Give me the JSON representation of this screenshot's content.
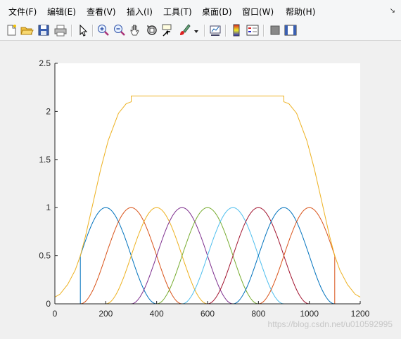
{
  "menu": {
    "items": [
      "文件(F)",
      "编辑(E)",
      "查看(V)",
      "插入(I)",
      "工具(T)",
      "桌面(D)",
      "窗口(W)",
      "帮助(H)"
    ],
    "dock_glyph": "↘"
  },
  "toolbar": {
    "buttons": [
      "new-figure-icon",
      "open-file-icon",
      "save-icon",
      "print-icon",
      "pointer-arrow-icon",
      "zoom-in-icon",
      "zoom-out-icon",
      "pan-hand-icon",
      "rotate-3d-icon",
      "data-cursor-icon",
      "brush-icon",
      "brush-dropdown-icon",
      "link-plot-icon",
      "colorbar-icon",
      "legend-icon",
      "hide-plot-tools-icon",
      "show-plot-tools-icon"
    ]
  },
  "watermark": "https://blog.csdn.net/u010592995",
  "chart_data": {
    "type": "line",
    "xlim": [
      0,
      1200
    ],
    "ylim": [
      0,
      2.5
    ],
    "xticks": [
      0,
      200,
      400,
      600,
      800,
      1000,
      1200
    ],
    "xtick_labels": [
      "0",
      "200",
      "400",
      "600",
      "800",
      "1000",
      "1200"
    ],
    "yticks": [
      0,
      0.5,
      1,
      1.5,
      2,
      2.5
    ],
    "ytick_labels": [
      "0",
      "0.5",
      "1",
      "1.5",
      "2",
      "2.5"
    ],
    "grid": false,
    "legend": "none",
    "series": [
      {
        "color": "#0072bd",
        "center": 200,
        "support": [
          100,
          300
        ],
        "points": [
          [
            0,
            0
          ],
          [
            100,
            0
          ],
          [
            100,
            0.5
          ],
          [
            150,
            0.85
          ],
          [
            200,
            1
          ],
          [
            250,
            0.85
          ],
          [
            300,
            0.5
          ],
          [
            350,
            0.15
          ],
          [
            400,
            0
          ],
          [
            1200,
            0
          ]
        ]
      },
      {
        "color": "#d95319",
        "center": 300,
        "support": [
          200,
          400
        ],
        "points": [
          [
            0,
            0
          ],
          [
            100,
            0
          ],
          [
            100,
            0.15
          ],
          [
            200,
            0.5
          ],
          [
            250,
            0.85
          ],
          [
            300,
            1
          ],
          [
            350,
            0.85
          ],
          [
            400,
            0.5
          ],
          [
            450,
            0.15
          ],
          [
            500,
            0
          ],
          [
            1200,
            0
          ]
        ]
      },
      {
        "color": "#edb120",
        "center": 400,
        "points": [
          [
            0,
            0
          ],
          [
            200,
            0
          ],
          [
            200,
            0.15
          ],
          [
            300,
            0.5
          ],
          [
            350,
            0.85
          ],
          [
            400,
            1
          ],
          [
            450,
            0.85
          ],
          [
            500,
            0.5
          ],
          [
            550,
            0.15
          ],
          [
            600,
            0
          ],
          [
            1200,
            0
          ]
        ]
      },
      {
        "color": "#7e2f8e",
        "center": 500,
        "points": [
          [
            0,
            0
          ],
          [
            300,
            0
          ],
          [
            300,
            0.15
          ],
          [
            400,
            0.5
          ],
          [
            450,
            0.85
          ],
          [
            500,
            1
          ],
          [
            550,
            0.85
          ],
          [
            600,
            0.5
          ],
          [
            650,
            0.15
          ],
          [
            700,
            0
          ],
          [
            1200,
            0
          ]
        ]
      },
      {
        "color": "#77ac30",
        "center": 600,
        "points": [
          [
            0,
            0
          ],
          [
            400,
            0
          ],
          [
            400,
            0.15
          ],
          [
            500,
            0.5
          ],
          [
            550,
            0.85
          ],
          [
            600,
            1
          ],
          [
            650,
            0.85
          ],
          [
            700,
            0.5
          ],
          [
            750,
            0.15
          ],
          [
            800,
            0
          ],
          [
            1200,
            0
          ]
        ]
      },
      {
        "color": "#4dbeee",
        "center": 700,
        "points": [
          [
            0,
            0
          ],
          [
            500,
            0
          ],
          [
            500,
            0.15
          ],
          [
            600,
            0.5
          ],
          [
            650,
            0.85
          ],
          [
            700,
            1
          ],
          [
            750,
            0.85
          ],
          [
            800,
            0.5
          ],
          [
            850,
            0.15
          ],
          [
            900,
            0
          ],
          [
            1200,
            0
          ]
        ]
      },
      {
        "color": "#a2142f",
        "center": 800,
        "points": [
          [
            0,
            0
          ],
          [
            600,
            0
          ],
          [
            600,
            0.15
          ],
          [
            700,
            0.5
          ],
          [
            750,
            0.85
          ],
          [
            800,
            1
          ],
          [
            850,
            0.85
          ],
          [
            900,
            0.5
          ],
          [
            950,
            0.15
          ],
          [
            1000,
            0
          ],
          [
            1200,
            0
          ]
        ]
      },
      {
        "color": "#0072bd",
        "center": 900,
        "points": [
          [
            0,
            0
          ],
          [
            700,
            0
          ],
          [
            700,
            0.15
          ],
          [
            800,
            0.5
          ],
          [
            850,
            0.85
          ],
          [
            900,
            1
          ],
          [
            950,
            0.85
          ],
          [
            1000,
            0.5
          ],
          [
            1050,
            0.15
          ],
          [
            1100,
            0
          ],
          [
            1200,
            0
          ]
        ]
      },
      {
        "color": "#d95319",
        "center": 1000,
        "points": [
          [
            0,
            0
          ],
          [
            800,
            0
          ],
          [
            800,
            0.15
          ],
          [
            900,
            0.5
          ],
          [
            950,
            0.85
          ],
          [
            1000,
            1
          ],
          [
            1050,
            0.85
          ],
          [
            1100,
            0.5
          ],
          [
            1100,
            0
          ],
          [
            1200,
            0
          ]
        ]
      },
      {
        "color": "#edb120",
        "name_shown": false,
        "points": [
          [
            0,
            0.07
          ],
          [
            20,
            0.1
          ],
          [
            50,
            0.2
          ],
          [
            80,
            0.35
          ],
          [
            100,
            0.5
          ],
          [
            120,
            0.7
          ],
          [
            150,
            1.05
          ],
          [
            180,
            1.4
          ],
          [
            200,
            1.6
          ],
          [
            210,
            1.7
          ],
          [
            250,
            1.98
          ],
          [
            280,
            2.08
          ],
          [
            300,
            2.1
          ],
          [
            300,
            2.16
          ],
          [
            900,
            2.16
          ],
          [
            900,
            2.1
          ],
          [
            920,
            2.08
          ],
          [
            950,
            1.98
          ],
          [
            990,
            1.7
          ],
          [
            1000,
            1.6
          ],
          [
            1020,
            1.4
          ],
          [
            1050,
            1.05
          ],
          [
            1080,
            0.7
          ],
          [
            1100,
            0.5
          ],
          [
            1120,
            0.35
          ],
          [
            1150,
            0.2
          ],
          [
            1180,
            0.1
          ],
          [
            1200,
            0.07
          ]
        ]
      }
    ]
  }
}
